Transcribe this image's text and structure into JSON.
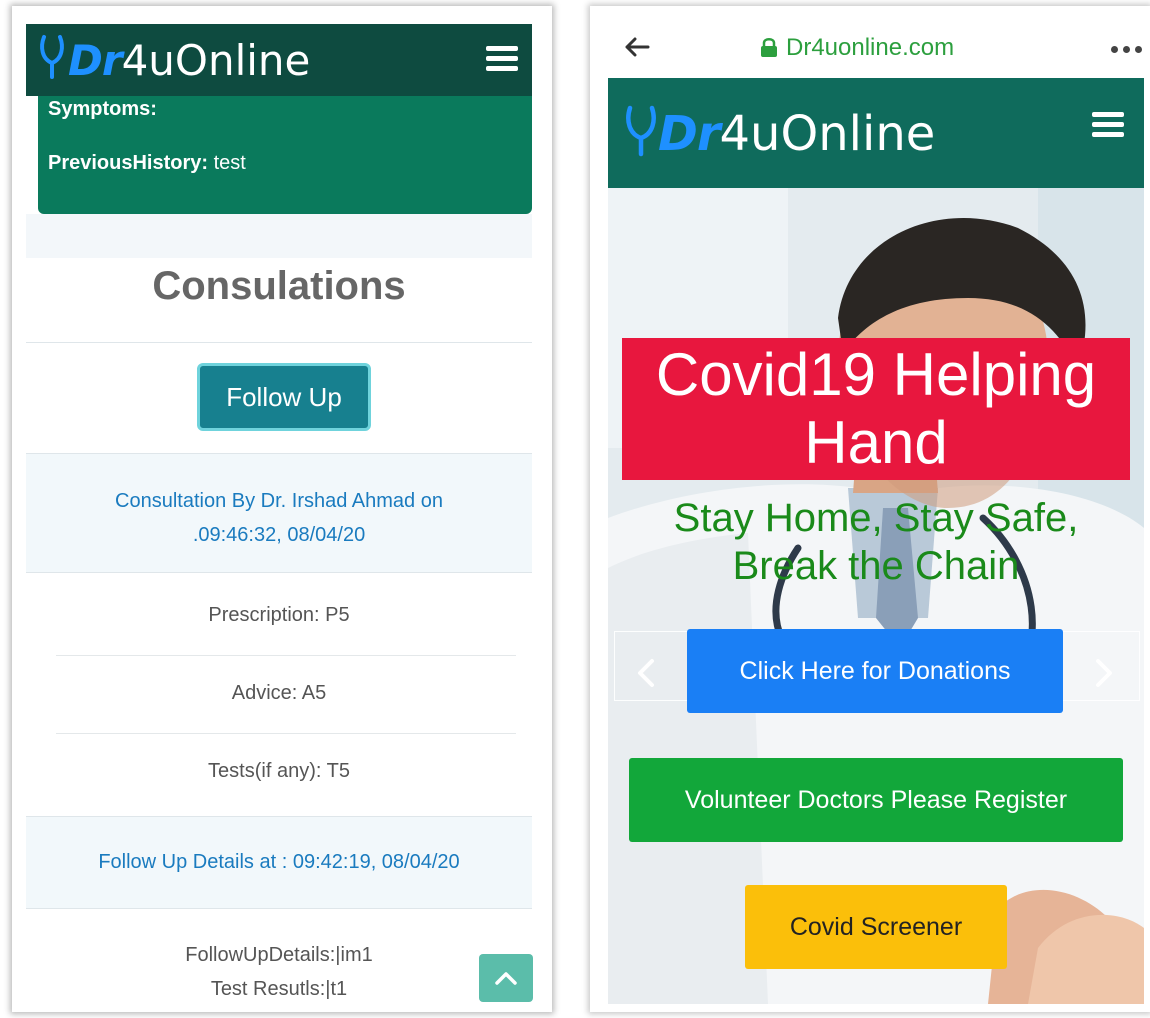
{
  "brand": {
    "logo_dr": "Dr",
    "logo_rest": "4uOnline"
  },
  "left": {
    "patient": {
      "symptoms_label": "Symptoms:",
      "history_label": "PreviousHistory:",
      "history_value": " test"
    },
    "section_title": "Consulations",
    "follow_up_label": "Follow Up",
    "consultation_header_line1": "Consultation By Dr. Irshad Ahmad on",
    "consultation_header_line2": ".09:46:32, 08/04/20",
    "prescription": "Prescription: P5",
    "advice": "Advice: A5",
    "tests": "Tests(if any): T5",
    "followup_header": "Follow Up Details at : 09:42:19, 08/04/20",
    "followup_details": "FollowUpDetails:|im1",
    "test_results": "Test Resutls:|t1"
  },
  "right": {
    "url": "Dr4uonline.com",
    "banner_line1": "Covid19 Helping",
    "banner_line2": "Hand",
    "slogan_line1": "Stay Home, Stay Safe,",
    "slogan_line2": "Break the Chain",
    "donations_label": "Click Here for Donations",
    "register_label": "Volunteer Doctors Please Register",
    "screener_label": "Covid Screener"
  },
  "icons": {
    "menu": "hamburger-icon",
    "stethoscope": "stethoscope-icon",
    "back": "back-arrow-icon",
    "lock": "lock-icon",
    "more": "more-dots-icon",
    "scroll_top": "chevron-up-icon",
    "carousel_prev": "chevron-left-icon",
    "carousel_next": "chevron-right-icon"
  },
  "colors": {
    "header_dark": "#0e4b40",
    "header_teal": "#0f6b5c",
    "card_green": "#0a7a5c",
    "follow_button": "#17808f",
    "link_blue": "#1a7bbf",
    "banner_red": "#e8173e",
    "slogan_green": "#1a8a1a",
    "donate_blue": "#1a7ff5",
    "register_green": "#12a73a",
    "screener_yellow": "#fbbf0a"
  }
}
